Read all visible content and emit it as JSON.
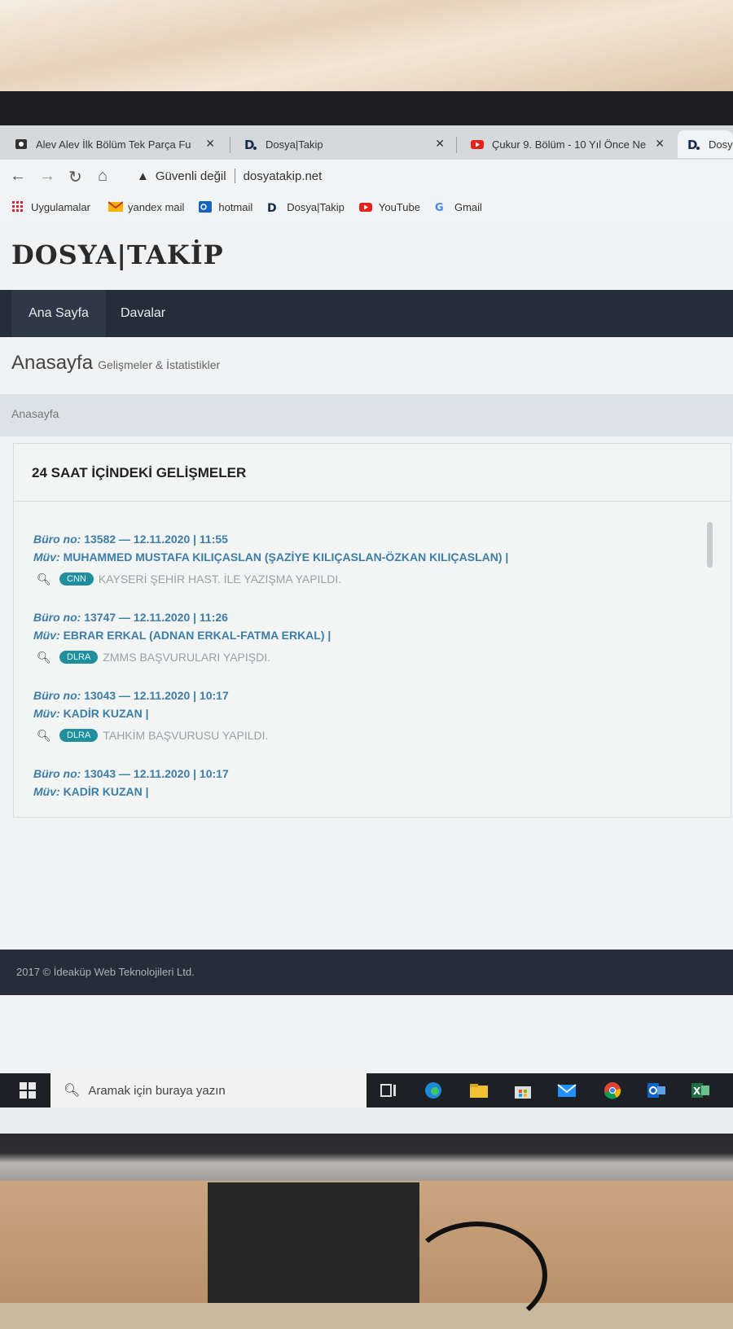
{
  "browser": {
    "tabs": [
      {
        "title": "Alev Alev İlk Bölüm Tek Parça Fu",
        "close": "✕"
      },
      {
        "title": "Dosya|Takip",
        "close": "✕"
      },
      {
        "title": "Çukur 9. Bölüm - 10 Yıl Önce Ne",
        "close": "✕"
      },
      {
        "title": "Dosy"
      }
    ],
    "address": {
      "security": "Güvenli değil",
      "url": "dosyatakip.net"
    },
    "bookmarks": [
      "Uygulamalar",
      "yandex mail",
      "hotmail",
      "Dosya|Takip",
      "YouTube",
      "Gmail"
    ]
  },
  "site": {
    "logo": "DOSYA|TAKİP",
    "nav": [
      "Ana Sayfa",
      "Davalar"
    ],
    "page_title": "Anasayfa",
    "page_subtitle": "Gelişmeler & İstatistikler",
    "breadcrumb": "Anasayfa",
    "panel_title": "24 SAAT İÇİNDEKİ GELİŞMELER",
    "entries": [
      {
        "buro_label": "Büro no:",
        "buro": "13582 — 12.11.2020 | 11:55",
        "muv_label": "Müv:",
        "muv": "MUHAMMED MUSTAFA KILIÇASLAN (ŞAZİYE KILIÇASLAN-ÖZKAN KILIÇASLAN) |",
        "badge": "CNN",
        "note": "KAYSERİ ŞEHİR HAST. İLE YAZIŞMA YAPILDI."
      },
      {
        "buro_label": "Büro no:",
        "buro": "13747 — 12.11.2020 | 11:26",
        "muv_label": "Müv:",
        "muv": "EBRAR ERKAL (ADNAN ERKAL-FATMA ERKAL) |",
        "badge": "DLRA",
        "note": "ZMMS BAŞVURULARI YAPIŞDI."
      },
      {
        "buro_label": "Büro no:",
        "buro": "13043 — 12.11.2020 | 10:17",
        "muv_label": "Müv:",
        "muv": "KADİR KUZAN |",
        "badge": "DLRA",
        "note": "TAHKİM BAŞVURUSU YAPILDI."
      },
      {
        "buro_label": "Büro no:",
        "buro": "13043 — 12.11.2020 | 10:17",
        "muv_label": "Müv:",
        "muv": "KADİR KUZAN |"
      }
    ],
    "footer": "2017 © İdeaküp Web Teknolojileri Ltd."
  },
  "taskbar": {
    "search_placeholder": "Aramak için buraya yazın"
  },
  "colors": {
    "nav_bg": "#252d3a",
    "link": "#3d7ea8",
    "badge": "#1f8fa0"
  }
}
